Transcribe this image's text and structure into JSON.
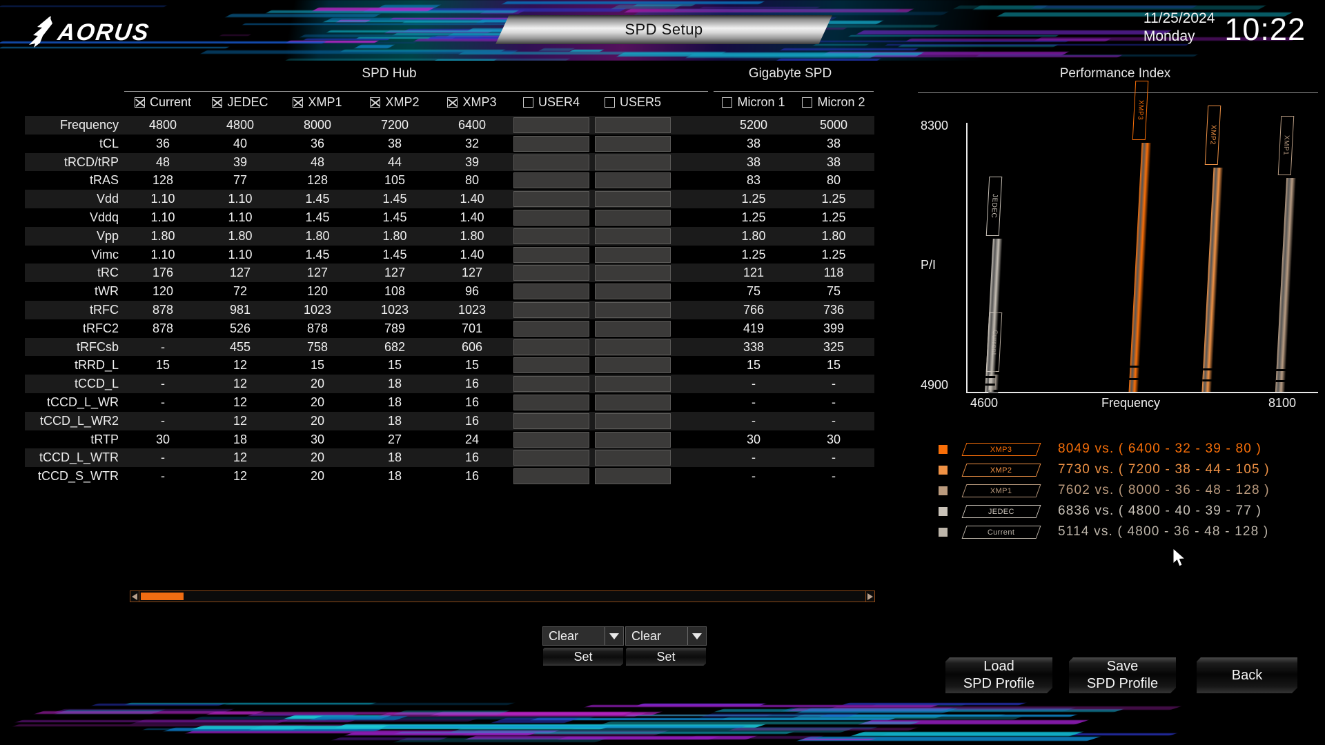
{
  "header": {
    "brand": "AORUS",
    "title": "SPD Setup",
    "date": "11/25/2024",
    "weekday": "Monday",
    "time": "10:22"
  },
  "sections": {
    "spd_hub": "SPD Hub",
    "gigabyte_spd": "Gigabyte SPD",
    "performance_index": "Performance Index"
  },
  "table": {
    "columns": [
      {
        "label": "Current",
        "checked": true,
        "type": "value"
      },
      {
        "label": "JEDEC",
        "checked": true,
        "type": "value"
      },
      {
        "label": "XMP1",
        "checked": true,
        "type": "value"
      },
      {
        "label": "XMP2",
        "checked": true,
        "type": "value"
      },
      {
        "label": "XMP3",
        "checked": true,
        "type": "value"
      },
      {
        "label": "USER4",
        "checked": false,
        "type": "input"
      },
      {
        "label": "USER5",
        "checked": false,
        "type": "input"
      },
      {
        "label": "Micron 1",
        "checked": false,
        "type": "value"
      },
      {
        "label": "Micron 2",
        "checked": false,
        "type": "value"
      }
    ],
    "rows": [
      {
        "label": "Frequency",
        "values": [
          "4800",
          "4800",
          "8000",
          "7200",
          "6400",
          "",
          "",
          "5200",
          "5000"
        ]
      },
      {
        "label": "tCL",
        "values": [
          "36",
          "40",
          "36",
          "38",
          "32",
          "",
          "",
          "38",
          "38"
        ]
      },
      {
        "label": "tRCD/tRP",
        "values": [
          "48",
          "39",
          "48",
          "44",
          "39",
          "",
          "",
          "38",
          "38"
        ]
      },
      {
        "label": "tRAS",
        "values": [
          "128",
          "77",
          "128",
          "105",
          "80",
          "",
          "",
          "83",
          "80"
        ]
      },
      {
        "label": "Vdd",
        "values": [
          "1.10",
          "1.10",
          "1.45",
          "1.45",
          "1.40",
          "",
          "",
          "1.25",
          "1.25"
        ]
      },
      {
        "label": "Vddq",
        "values": [
          "1.10",
          "1.10",
          "1.45",
          "1.45",
          "1.40",
          "",
          "",
          "1.25",
          "1.25"
        ]
      },
      {
        "label": "Vpp",
        "values": [
          "1.80",
          "1.80",
          "1.80",
          "1.80",
          "1.80",
          "",
          "",
          "1.80",
          "1.80"
        ]
      },
      {
        "label": "Vimc",
        "values": [
          "1.10",
          "1.10",
          "1.45",
          "1.45",
          "1.40",
          "",
          "",
          "1.25",
          "1.25"
        ]
      },
      {
        "label": "tRC",
        "values": [
          "176",
          "127",
          "127",
          "127",
          "127",
          "",
          "",
          "121",
          "118"
        ]
      },
      {
        "label": "tWR",
        "values": [
          "120",
          "72",
          "120",
          "108",
          "96",
          "",
          "",
          "75",
          "75"
        ]
      },
      {
        "label": "tRFC",
        "values": [
          "878",
          "981",
          "1023",
          "1023",
          "1023",
          "",
          "",
          "766",
          "736"
        ]
      },
      {
        "label": "tRFC2",
        "values": [
          "878",
          "526",
          "878",
          "789",
          "701",
          "",
          "",
          "419",
          "399"
        ]
      },
      {
        "label": "tRFCsb",
        "values": [
          "-",
          "455",
          "758",
          "682",
          "606",
          "",
          "",
          "338",
          "325"
        ]
      },
      {
        "label": "tRRD_L",
        "values": [
          "15",
          "12",
          "15",
          "15",
          "15",
          "",
          "",
          "15",
          "15"
        ]
      },
      {
        "label": "tCCD_L",
        "values": [
          "-",
          "12",
          "20",
          "18",
          "16",
          "",
          "",
          "-",
          "-"
        ]
      },
      {
        "label": "tCCD_L_WR",
        "values": [
          "-",
          "12",
          "20",
          "18",
          "16",
          "",
          "",
          "-",
          "-"
        ]
      },
      {
        "label": "tCCD_L_WR2",
        "values": [
          "-",
          "12",
          "20",
          "18",
          "16",
          "",
          "",
          "-",
          "-"
        ]
      },
      {
        "label": "tRTP",
        "values": [
          "30",
          "18",
          "30",
          "27",
          "24",
          "",
          "",
          "30",
          "30"
        ]
      },
      {
        "label": "tCCD_L_WTR",
        "values": [
          "-",
          "12",
          "20",
          "18",
          "16",
          "",
          "",
          "-",
          "-"
        ]
      },
      {
        "label": "tCCD_S_WTR",
        "values": [
          "-",
          "12",
          "20",
          "18",
          "16",
          "",
          "",
          "-",
          "-"
        ]
      }
    ]
  },
  "controls": {
    "dropdown1": {
      "value": "Clear"
    },
    "dropdown2": {
      "value": "Clear"
    },
    "set1": "Set",
    "set2": "Set"
  },
  "actions": {
    "load": {
      "line1": "Load",
      "line2": "SPD Profile"
    },
    "save": {
      "line1": "Save",
      "line2": "SPD Profile"
    },
    "back": {
      "line1": "Back",
      "line2": ""
    }
  },
  "chart_data": {
    "type": "bar",
    "title": "Performance Index",
    "xlabel": "Frequency",
    "ylabel": "P/I",
    "xlim": [
      4600,
      8100
    ],
    "ylim": [
      4900,
      8300
    ],
    "xticks": [
      "4600",
      "8100"
    ],
    "yticks": [
      "8300",
      "4900"
    ],
    "grid": false,
    "legend_position": "below",
    "categories": [
      "Current",
      "JEDEC",
      "XMP1",
      "XMP2",
      "XMP3"
    ],
    "series": [
      {
        "name": "Current",
        "frequency": 4800,
        "pi": 5114,
        "color": "#b8ada1"
      },
      {
        "name": "JEDEC",
        "frequency": 4800,
        "pi": 6836,
        "color": "#c6bfb5"
      },
      {
        "name": "XMP1",
        "frequency": 8000,
        "pi": 7602,
        "color": "#b99d84"
      },
      {
        "name": "XMP2",
        "frequency": 7200,
        "pi": 7730,
        "color": "#f09245"
      },
      {
        "name": "XMP3",
        "frequency": 6400,
        "pi": 8049,
        "color": "#f96f08"
      }
    ],
    "legend": [
      {
        "tag": "XMP3",
        "pi": "8049",
        "vs": "vs.",
        "spec": "( 6400  -  32  -  39  -  80 )",
        "color": "#f96f08"
      },
      {
        "tag": "XMP2",
        "pi": "7730",
        "vs": "vs.",
        "spec": "( 7200  -  38  -  44  -  105 )",
        "color": "#f09245"
      },
      {
        "tag": "XMP1",
        "pi": "7602",
        "vs": "vs.",
        "spec": "( 8000  -  36  -  48  -  128 )",
        "color": "#bb9b7e"
      },
      {
        "tag": "JEDEC",
        "pi": "6836",
        "vs": "vs.",
        "spec": "( 4800  -  40  -  39  -  77 )",
        "color": "#c9c2b8"
      },
      {
        "tag": "Current",
        "pi": "5114",
        "vs": "vs.",
        "spec": "( 4800  -  36  -  48  -  128 )",
        "color": "#bdb5aa"
      }
    ]
  },
  "colors": {
    "accent": "#f96f08",
    "accent2": "#f09245",
    "panel": "#1b1b1b",
    "text": "#f0f0f0"
  }
}
